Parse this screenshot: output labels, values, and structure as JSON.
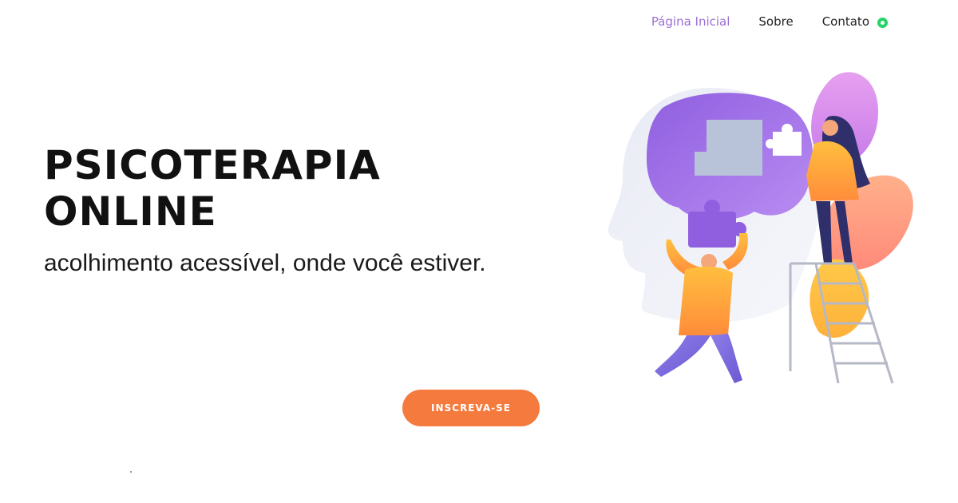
{
  "nav": {
    "items": [
      {
        "label": "Página Inicial",
        "active": true
      },
      {
        "label": "Sobre",
        "active": false
      },
      {
        "label": "Contato",
        "active": false,
        "icon": "whatsapp-icon"
      }
    ]
  },
  "hero": {
    "title_line1": "PSICOTERAPIA",
    "title_line2": "ONLINE",
    "subtitle": "acolhimento acessível, onde você estiver.",
    "cta_label": "INSCREVA-SE"
  },
  "colors": {
    "accent_nav": "#9b6fd6",
    "cta": "#f47a3d",
    "whatsapp": "#25d366"
  }
}
